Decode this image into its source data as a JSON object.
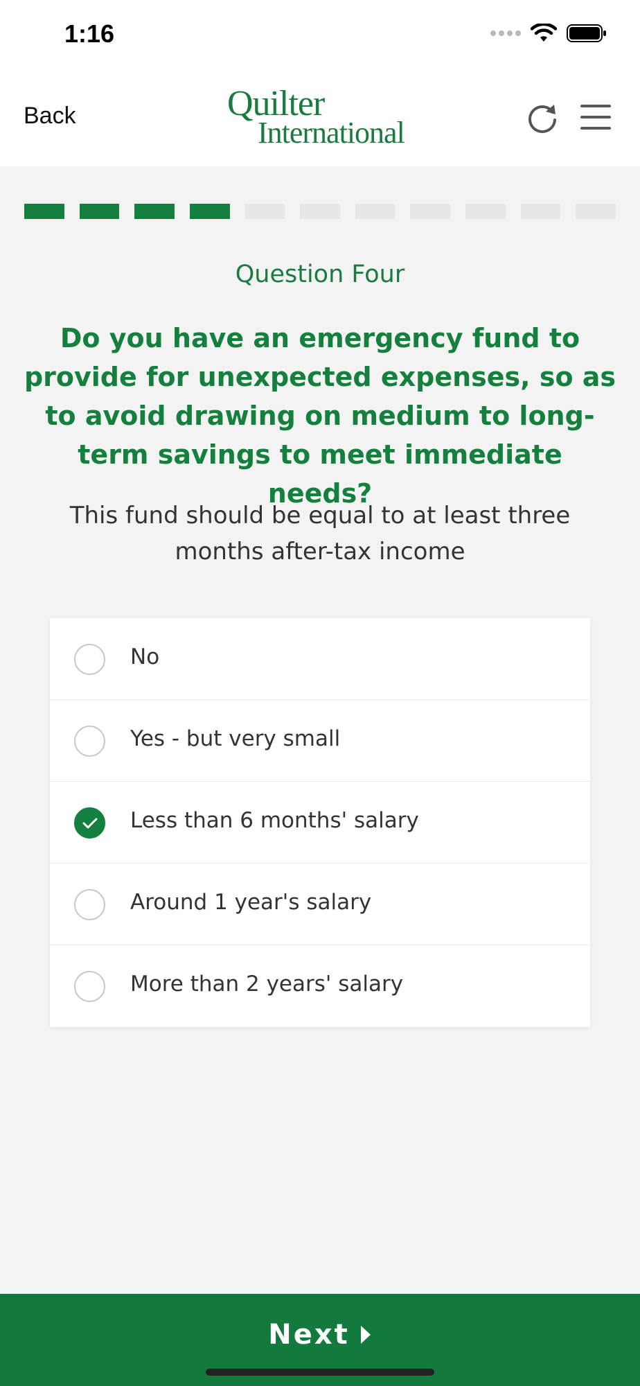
{
  "status_bar": {
    "time": "1:16"
  },
  "nav": {
    "back_label": "Back",
    "logo_line1": "Quilter",
    "logo_line2": "International"
  },
  "progress": {
    "completed": 4,
    "total": 11
  },
  "question": {
    "number_label": "Question Four",
    "title": "Do you have an emergency fund to provide for unexpected expenses, so as to avoid drawing on medium to long-term savings to meet immediate needs?",
    "hint": "This fund should be equal to at least three months after-tax income"
  },
  "options": [
    {
      "label": "No",
      "selected": false
    },
    {
      "label": "Yes - but very small",
      "selected": false
    },
    {
      "label": "Less than 6 months' salary",
      "selected": true
    },
    {
      "label": "Around 1 year's salary",
      "selected": false
    },
    {
      "label": "More than 2 years' salary",
      "selected": false
    }
  ],
  "footer": {
    "next_label": "Next"
  },
  "colors": {
    "brand_green": "#14803f",
    "background": "#f3f3f3"
  }
}
